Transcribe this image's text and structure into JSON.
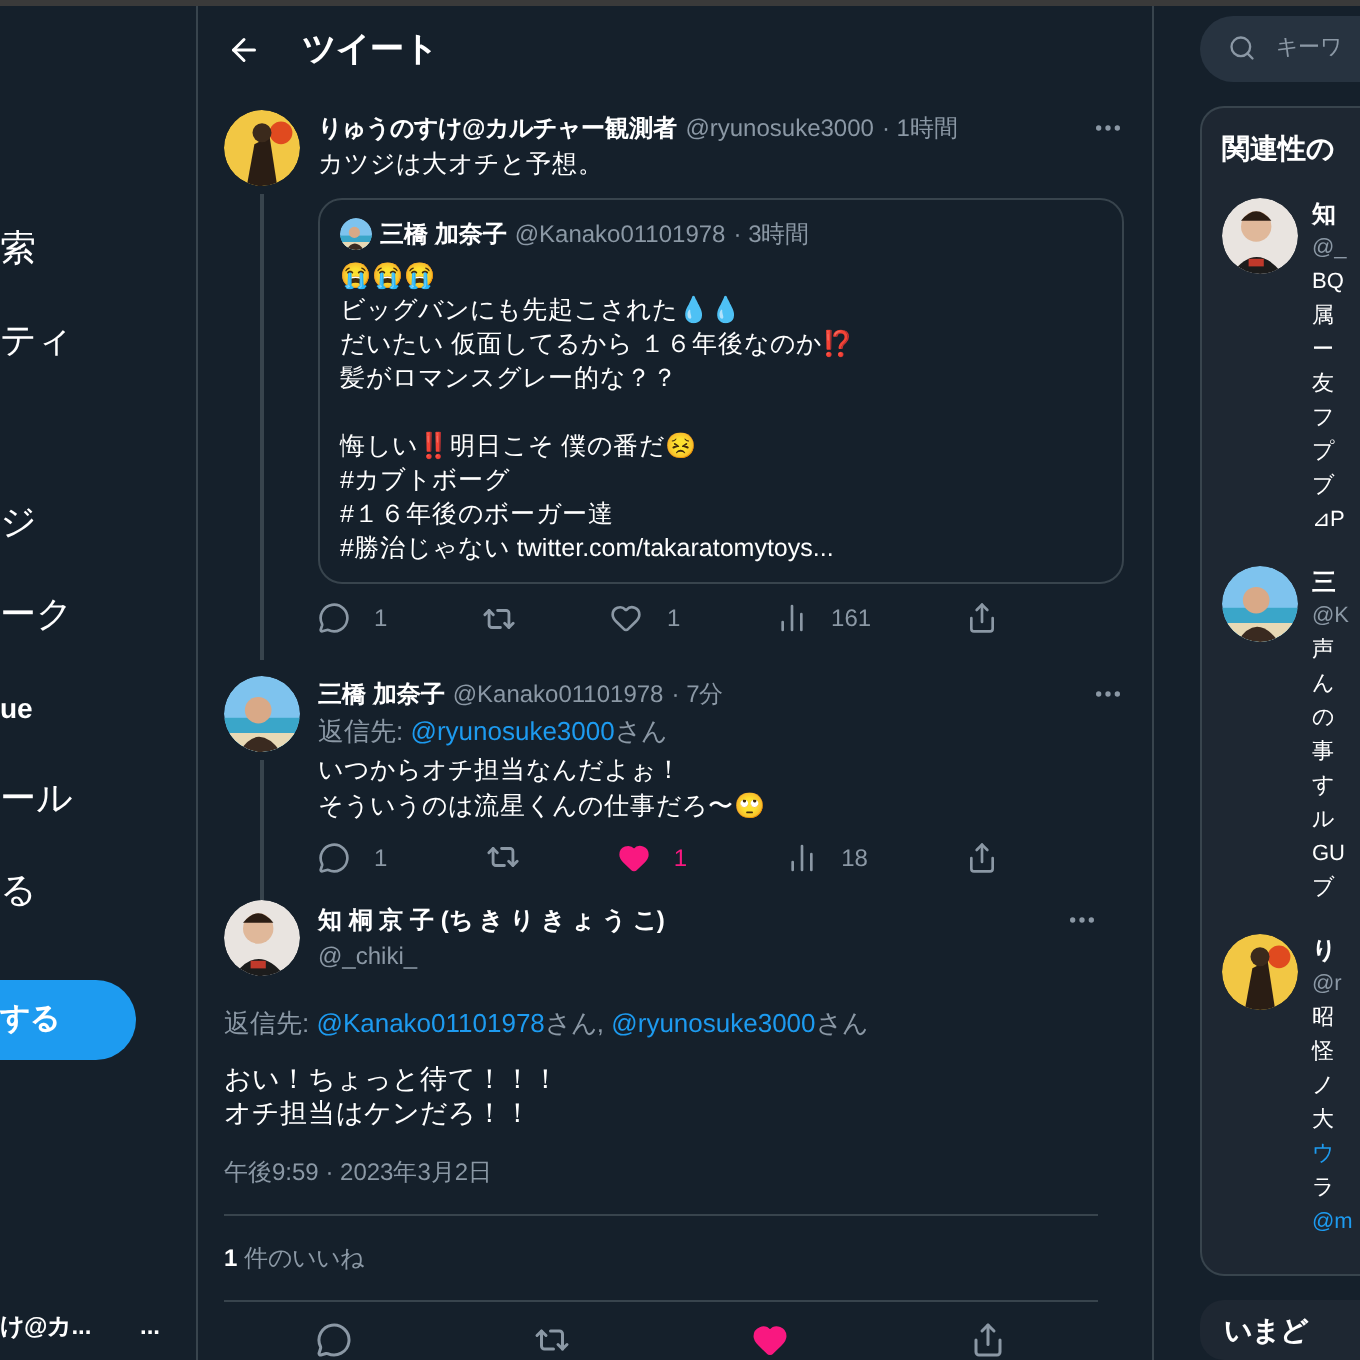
{
  "sidebar": {
    "items": [
      {
        "label": "索"
      },
      {
        "label": "ティ"
      },
      {
        "label": "ジ"
      },
      {
        "label": "ーク"
      },
      {
        "label": "ue",
        "kind": "small"
      },
      {
        "label": "ール"
      },
      {
        "label": "る"
      }
    ],
    "post_button": "する",
    "account": {
      "name": "け@カ...",
      "more": "..."
    }
  },
  "header": {
    "title": "ツイート"
  },
  "tweets": [
    {
      "name": "りゅうのすけ@カルチャー観測者",
      "handle": "@ryunosuke3000",
      "time": "· 1時間",
      "lines": [
        "カツジは大オチと予想。"
      ],
      "quote": {
        "name": "三橋 加奈子",
        "handle": "@Kanako01101978",
        "time": "· 3時間",
        "paragraphs": [
          [
            "😭😭😭",
            "ビッグバンにも先起こされた💧💧",
            "だいたい 仮面してるから １６年後なのか⁉️",
            "髪がロマンスグレー的な？？"
          ],
          [
            "悔しい‼️明日こそ 僕の番だ😣",
            "#カブトボーグ",
            "#１６年後のボーガー達",
            "#勝治じゃない twitter.com/takaratomytoys..."
          ]
        ]
      },
      "actions": {
        "replies": "1",
        "likes": "1",
        "liked": false,
        "views": "161"
      }
    },
    {
      "name": "三橋 加奈子",
      "handle": "@Kanako01101978",
      "time": "· 7分",
      "reply_label": "返信先:",
      "mentions": [
        {
          "handle": "@ryunosuke3000",
          "suffix": "さん"
        }
      ],
      "lines": [
        "いつからオチ担当なんだよぉ！",
        "そういうのは流星くんの仕事だろ〜🙄"
      ],
      "actions": {
        "replies": "1",
        "likes": "1",
        "liked": true,
        "views": "18"
      }
    }
  ],
  "main_tweet": {
    "name": "知 桐 京 子 (ち き り き ょ う こ)",
    "handle": "@_chiki_",
    "reply_label": "返信先:",
    "mentions": [
      {
        "handle": "@Kanako01101978",
        "suffix": "さん,"
      },
      {
        "handle": "@ryunosuke3000",
        "suffix": "さん"
      }
    ],
    "lines": [
      "おい！ちょっと待て！！！",
      "オチ担当はケンだろ！！"
    ],
    "timestamp": "午後9:59 · 2023年3月2日",
    "like_count": "1",
    "like_label": "件のいいね",
    "liked": true
  },
  "right": {
    "search": {
      "placeholder": "キーワ"
    },
    "related": {
      "title": "関連性の",
      "users": [
        {
          "name": "知",
          "handle": "@_",
          "bio": [
            {
              "text": "BQ"
            },
            {
              "text": "属"
            },
            {
              "text": "ー"
            },
            {
              "text": "友"
            },
            {
              "text": "フ"
            },
            {
              "text": "プ"
            },
            {
              "text": "ブ"
            },
            {
              "text": "⊿P"
            }
          ]
        },
        {
          "name": "三",
          "handle": "@K",
          "bio": [
            {
              "text": "声"
            },
            {
              "text": "ん"
            },
            {
              "text": "の"
            },
            {
              "text": "事"
            },
            {
              "text": "す"
            },
            {
              "text": "ル"
            },
            {
              "text": "GU"
            },
            {
              "text": "ブ"
            }
          ]
        },
        {
          "name": "り",
          "handle": "@r",
          "bio": [
            {
              "text": "昭"
            },
            {
              "text": "怪"
            },
            {
              "text": "ノ"
            },
            {
              "text": "大"
            },
            {
              "text": "ウ",
              "link": true
            },
            {
              "text": "ラ",
              "link": false
            },
            {
              "text": "@m",
              "link": true
            }
          ]
        }
      ]
    },
    "trending_title": "いまど"
  }
}
